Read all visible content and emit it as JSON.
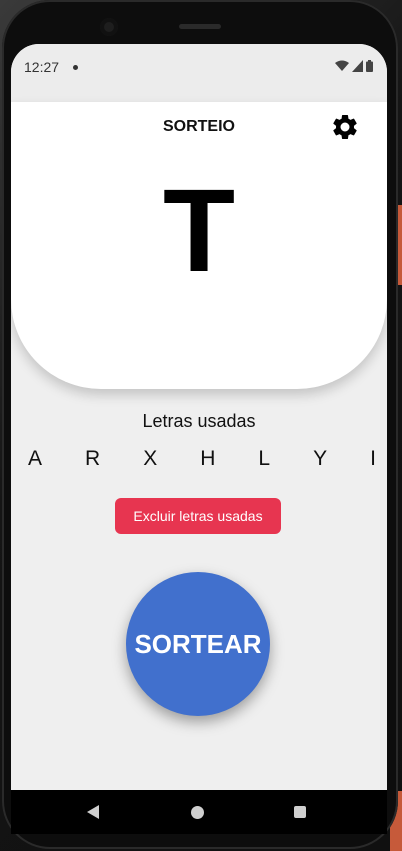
{
  "status_bar": {
    "time": "12:27"
  },
  "header": {
    "title": "SORTEIO",
    "settings_icon": "gear-icon"
  },
  "current_letter": "T",
  "used_letters": {
    "title": "Letras usadas",
    "letters": [
      "A",
      "R",
      "X",
      "H",
      "L",
      "Y",
      "I"
    ]
  },
  "buttons": {
    "exclude_label": "Excluir letras usadas",
    "draw_label": "SORTEAR"
  },
  "colors": {
    "exclude": "#e73550",
    "draw": "#4170cd",
    "background": "#efefef"
  },
  "nav": {
    "back_icon": "back-triangle-icon",
    "home_icon": "home-circle-icon",
    "recents_icon": "recents-square-icon"
  }
}
